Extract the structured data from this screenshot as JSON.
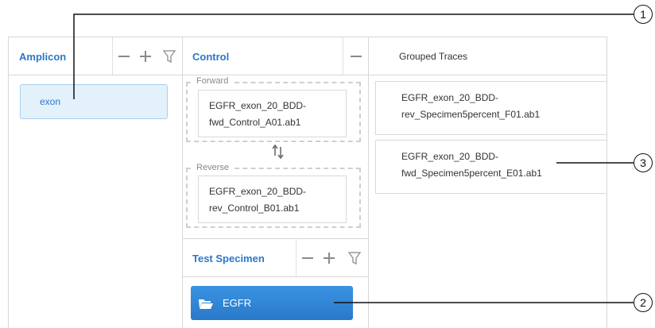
{
  "amplicon": {
    "header": "Amplicon",
    "item": "exon"
  },
  "control": {
    "header": "Control",
    "forward_label": "Forward",
    "forward_trace_line1": "EGFR_exon_20_BDD-",
    "forward_trace_line2": "fwd_Control_A01.ab1",
    "reverse_label": "Reverse",
    "reverse_trace_line1": "EGFR_exon_20_BDD-",
    "reverse_trace_line2": "rev_Control_B01.ab1"
  },
  "grouped": {
    "header": "Grouped Traces",
    "traces": [
      {
        "line1": "EGFR_exon_20_BDD-",
        "line2": "rev_Specimen5percent_F01.ab1"
      },
      {
        "line1": "EGFR_exon_20_BDD-",
        "line2": "fwd_Specimen5percent_E01.ab1"
      }
    ]
  },
  "test_specimen": {
    "header": "Test Specimen",
    "folder": "EGFR"
  },
  "callouts": [
    "1",
    "2",
    "3"
  ],
  "colors": {
    "accent": "#2b78c8",
    "folder_bg": "#2f86d8",
    "amplicon_item_bg": "#e3f1fb"
  }
}
